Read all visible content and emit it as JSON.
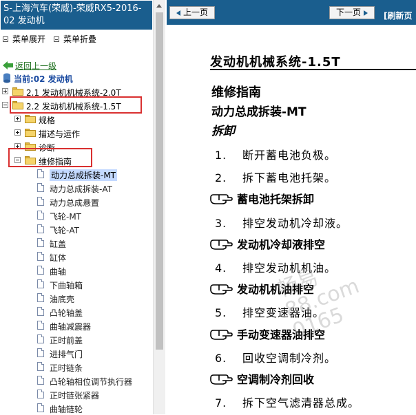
{
  "left": {
    "title": "S-上海汽车(荣威)-荣威RX5-2016- 02 发动机",
    "menu": {
      "expand": "菜单展开",
      "collapse": "菜单折叠"
    },
    "back": "返回上一级",
    "current": "当前:02 发动机",
    "tree": [
      {
        "label": "2.1 发动机机械系统-2.0T"
      },
      {
        "label": "2.2 发动机机械系统-1.5T"
      },
      {
        "label": "规格"
      },
      {
        "label": "描述与运作"
      },
      {
        "label": "诊断"
      },
      {
        "label": "维修指南"
      }
    ],
    "leaves": [
      "动力总成拆装-MT",
      "动力总成拆装-AT",
      "动力总成悬置",
      "飞轮-MT",
      "飞轮-AT",
      "缸盖",
      "缸体",
      "曲轴",
      "下曲轴箱",
      "油底壳",
      "凸轮轴盖",
      "曲轴减震器",
      "正时前盖",
      "进排气门",
      "正时链条",
      "凸轮轴相位调节执行器",
      "正时链张紧器",
      "曲轴链轮"
    ]
  },
  "nav": {
    "prev": "上一页",
    "next": "下一页",
    "refresh": "[刷新页"
  },
  "doc": {
    "title": "发动机机械系统-1.5T",
    "h1": "维修指南",
    "h2": "动力总成拆装-MT",
    "h3": "拆卸",
    "steps": [
      {
        "n": "1.",
        "t": "断开蓄电池负极。"
      },
      {
        "n": "2.",
        "t": "拆下蓄电池托架。"
      },
      {
        "n": "3.",
        "t": "排空发动机冷却液。"
      },
      {
        "n": "4.",
        "t": "排空发动机机油。"
      },
      {
        "n": "5.",
        "t": "排空变速器油。"
      },
      {
        "n": "6.",
        "t": "回收空调制冷剂。"
      },
      {
        "n": "7.",
        "t": "拆下空气滤清器总成。"
      }
    ],
    "subs": [
      "蓄电池托架拆卸",
      "发动机冷却液排空",
      "发动机机油排空",
      "手动变速器油排空",
      "空调制冷剂回收"
    ],
    "watermark": "畅易\n88.com\n0165"
  },
  "colors": {
    "header": "#1a5e8e",
    "highlight": "#d93030",
    "selected": "#c3d9ff",
    "link": "#1a6e1a"
  }
}
